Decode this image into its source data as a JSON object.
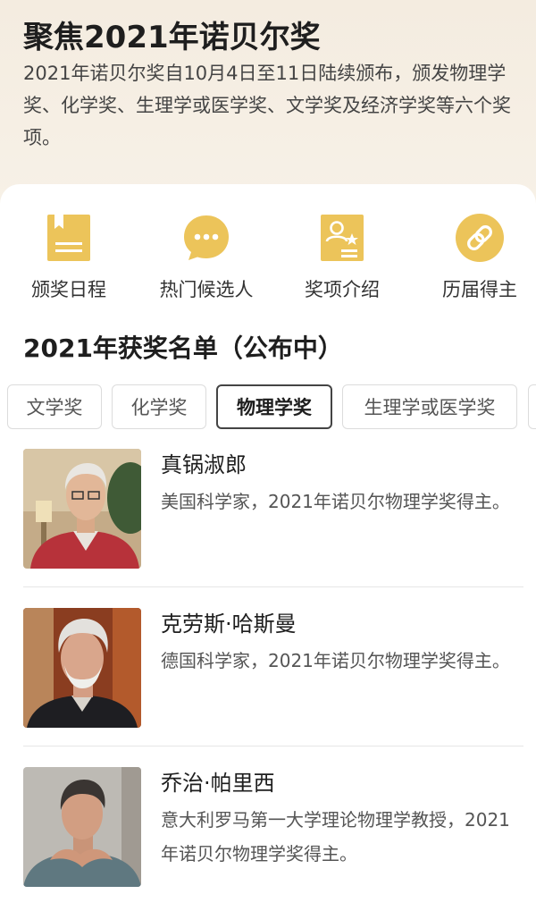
{
  "header": {
    "title": "聚焦2021年诺贝尔奖",
    "intro": "2021年诺贝尔奖自10月4日至11日陆续颁布，颁发物理学奖、化学奖、生理学或医学奖、文学奖及经济学奖等六个奖项。"
  },
  "nav": [
    {
      "label": "颁奖日程",
      "icon": "calendar-icon"
    },
    {
      "label": "热门候选人",
      "icon": "chat-bubble-icon"
    },
    {
      "label": "奖项介绍",
      "icon": "profile-card-icon"
    },
    {
      "label": "历届得主",
      "icon": "link-icon"
    }
  ],
  "section_title": "2021年获奖名单（公布中）",
  "tabs": [
    "文学奖",
    "化学奖",
    "物理学奖",
    "生理学或医学奖"
  ],
  "active_tab": "物理学奖",
  "laureates": [
    {
      "name": "真锅淑郎",
      "desc": "美国科学家，2021年诺贝尔物理学奖得主。"
    },
    {
      "name": "克劳斯·哈斯曼",
      "desc": "德国科学家，2021年诺贝尔物理学奖得主。"
    },
    {
      "name": "乔治·帕里西",
      "desc": "意大利罗马第一大学理论物理学教授，2021年诺贝尔物理学奖得主。"
    }
  ],
  "colors": {
    "accent": "#ecc45a",
    "background": "#f6efe4",
    "card": "#ffffff"
  }
}
